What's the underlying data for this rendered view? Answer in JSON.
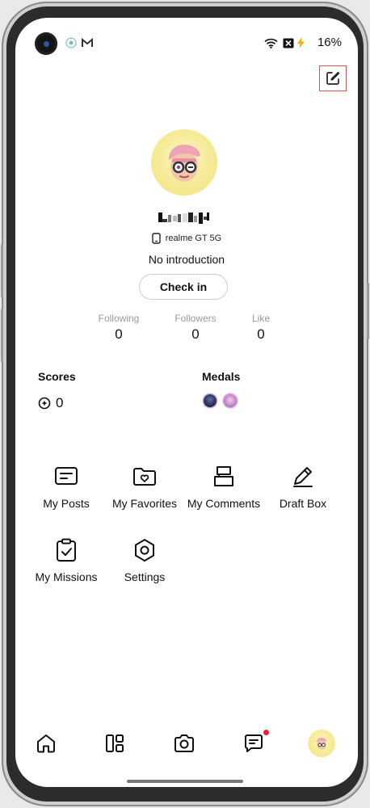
{
  "status_bar": {
    "battery": "16%"
  },
  "profile": {
    "device": "realme GT 5G",
    "intro": "No introduction",
    "checkin_label": "Check in",
    "stats": [
      {
        "label": "Following",
        "value": "0"
      },
      {
        "label": "Followers",
        "value": "0"
      },
      {
        "label": "Like",
        "value": "0"
      }
    ]
  },
  "scores": {
    "title": "Scores",
    "value": "0"
  },
  "medals": {
    "title": "Medals"
  },
  "menu": [
    {
      "label": "My Posts",
      "icon": "posts-icon"
    },
    {
      "label": "My Favorites",
      "icon": "favorites-folder-icon"
    },
    {
      "label": "My Comments",
      "icon": "comments-icon"
    },
    {
      "label": "Draft Box",
      "icon": "pencil-icon"
    },
    {
      "label": "My Missions",
      "icon": "clipboard-check-icon"
    },
    {
      "label": "Settings",
      "icon": "hexagon-settings-icon"
    }
  ],
  "bottom_nav": [
    "home-icon",
    "grid-icon",
    "camera-icon",
    "messages-icon",
    "profile-avatar"
  ],
  "colors": {
    "accent_red": "#e0262f",
    "edit_highlight": "#d9505d",
    "avatar_bg": "#f3e68a"
  }
}
